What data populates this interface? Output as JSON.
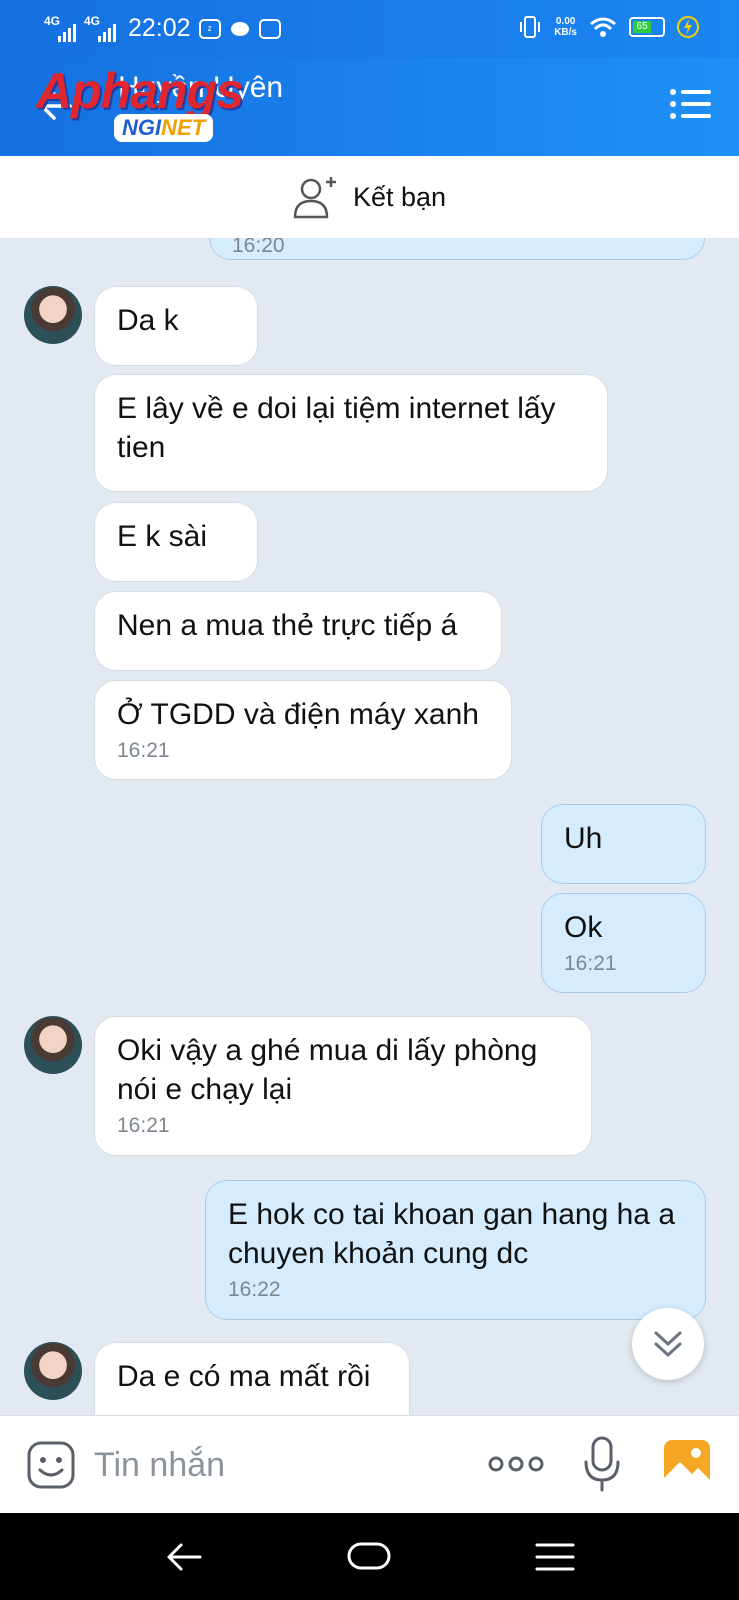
{
  "status_bar": {
    "network_1": "4G",
    "network_2": "4G",
    "time": "22:02",
    "speed_value": "0.00",
    "speed_unit": "KB/s",
    "battery": "65"
  },
  "header": {
    "contact_name": "Huyền Uyên",
    "watermark_brand": "Aphangs",
    "watermark_badge_left": "NGI",
    "watermark_badge_right": "NET"
  },
  "friend_bar": {
    "label": "Kết bạn"
  },
  "chat": {
    "partial_top_time": "16:20",
    "messages": [
      {
        "side": "in",
        "text": "Da k",
        "time": ""
      },
      {
        "side": "in",
        "text": "E lây về e doi lại tiệm internet lấy tien",
        "time": ""
      },
      {
        "side": "in",
        "text": "E k sài",
        "time": ""
      },
      {
        "side": "in",
        "text": "Nen a mua thẻ trực tiếp á",
        "time": ""
      },
      {
        "side": "in",
        "text": "Ở TGDD và điện máy xanh",
        "time": "16:21"
      },
      {
        "side": "out",
        "text": "Uh",
        "time": ""
      },
      {
        "side": "out",
        "text": "Ok",
        "time": "16:21"
      },
      {
        "side": "in",
        "text": "Oki vậy a ghé mua di lấy phòng nói e chạy lại",
        "time": "16:21"
      },
      {
        "side": "out",
        "text": "E hok co tai khoan gan hang ha a chuyen khoản cung dc",
        "time": "16:22"
      },
      {
        "side": "in",
        "text": "Da e có ma mất rồi",
        "time": ""
      }
    ]
  },
  "input": {
    "placeholder": "Tin nhắn"
  },
  "icons": {
    "emoji": "emoji-icon",
    "more": "more-dots-icon",
    "mic": "mic-icon",
    "image": "image-icon",
    "scroll": "chevron-double-down-icon"
  },
  "colors": {
    "header_blue": "#1570e0",
    "incoming_bubble": "#ffffff",
    "outgoing_bubble": "#d4ecfd",
    "chat_background": "#e2e9f1",
    "image_icon": "#f5a623"
  }
}
